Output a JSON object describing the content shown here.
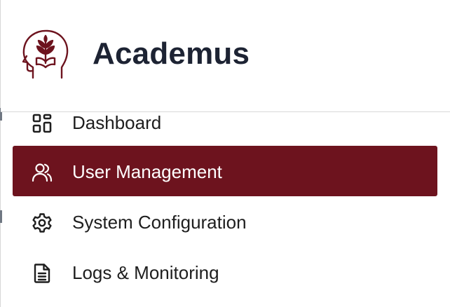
{
  "brand": {
    "name": "Academus",
    "logo_icon": "head-with-sprout-logo",
    "logo_color": "#6d131e"
  },
  "nav": {
    "active_bg": "#6d131e",
    "items": [
      {
        "label": "Dashboard",
        "icon": "dashboard-grid-icon",
        "active": false
      },
      {
        "label": "User Management",
        "icon": "users-icon",
        "active": true
      },
      {
        "label": "System Configuration",
        "icon": "gear-icon",
        "active": false
      },
      {
        "label": "Logs & Monitoring",
        "icon": "document-icon",
        "active": false
      }
    ]
  }
}
